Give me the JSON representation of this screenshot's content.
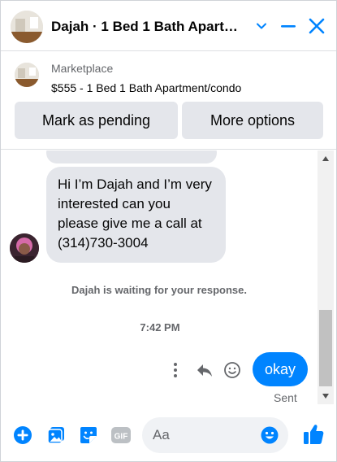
{
  "header": {
    "title": "Dajah · 1 Bed 1 Bath Apartment/condo",
    "avatar_icon": "apartment-photo"
  },
  "marketplace": {
    "label": "Marketplace",
    "listing": "$555 - 1 Bed 1 Bath Apartment/condo",
    "mark_pending_label": "Mark as pending",
    "more_options_label": "More options"
  },
  "messages": {
    "incoming_text": "Hi I’m Dajah and I’m very interested can you please give me a call at (314)730-3004",
    "waiting_text": "Dajah is waiting for your response.",
    "timestamp": "7:42 PM",
    "outgoing_text": "okay",
    "sent_status": "Sent"
  },
  "composer": {
    "placeholder": "Aa"
  },
  "colors": {
    "accent": "#0084ff",
    "bubble_gray": "#e4e6eb",
    "secondary_text": "#65676b"
  }
}
